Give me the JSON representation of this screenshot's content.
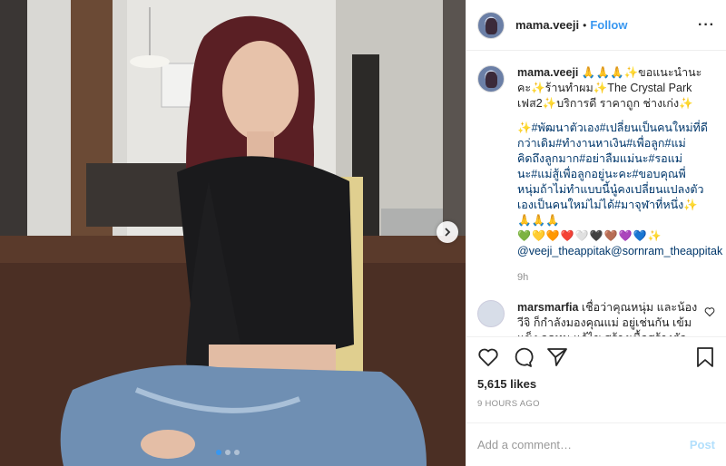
{
  "post": {
    "username": "mama.veeji",
    "follow_label": "Follow",
    "separator": "•",
    "more_icon": "more-horizontal-icon",
    "caption": {
      "username": "mama.veeji",
      "line1": "🙏🙏🙏✨ขอแนะนำนะคะ✨ร้านทำผม✨The Crystal Park เฟส2✨บริการดี ราคาถูก ช่างเก่ง✨",
      "line2": "✨#พัฒนาตัวเอง#เปลี่ยนเป็นคนใหม่ที่ดีกว่าเดิม#ทำงานหาเงิน#เพื่อลูก#แม่คิดถึงลูกมาก#อย่าลืมแม่นะ#รอแม่นะ#แม่สู้เพื่อลูกอยู่นะคะ#ขอบคุณพี่หนุ่มถ้าไม่ทำแบบนี้นู๋คงเปลี่ยนแปลงตัวเองเป็นคนใหม่ไม่ได้#มาจุฬาที่หนึ่ง✨🙏🙏🙏",
      "hearts": "💚💛🧡❤️🤍🖤🤎💜💙✨",
      "mentions": "@veeji_theappitak@sornram_theappitak",
      "time": "9h"
    },
    "comment": {
      "username": "marsmarfia",
      "text": "เชื่อว่าคุณหนุ่ม และน้องวีจิ ก็กำลังมองคุณแม่ อยู่เช่นกัน เข้มแข็ง อดทน แก้ไข สร้างเนื้อสร้างตัว ใหม่เพื่อน้องวีจิ และเพื่อตัวเองนะคะ"
    },
    "likes": "5,615 likes",
    "posted_ago": "9 HOURS AGO",
    "comment_placeholder": "Add a comment…",
    "post_button": "Post",
    "carousel": {
      "total": 3,
      "active_index": 0
    }
  },
  "colors": {
    "link_blue": "#3897f0",
    "post_disabled": "#b2dffc",
    "muted": "#8e8e8e",
    "hashtag": "#00376b"
  }
}
